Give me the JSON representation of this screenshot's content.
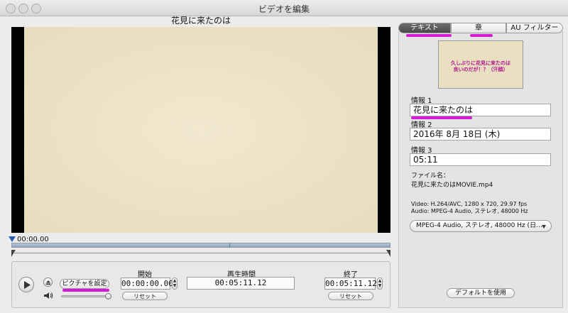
{
  "window": {
    "title": "ビデオを編集"
  },
  "video": {
    "title": "花見に来たのは",
    "timecode": "00:00.00"
  },
  "controls": {
    "set_picture_label": "ピクチャを設定",
    "start": {
      "label": "開始",
      "value": "00:00:00.00",
      "reset": "リセット"
    },
    "duration": {
      "label": "再生時間",
      "value": "00:05:11.12"
    },
    "end": {
      "label": "終了",
      "value": "00:05:11.12",
      "reset": "リセット"
    }
  },
  "tabs": [
    {
      "label": "テキスト",
      "active": true
    },
    {
      "label": "章",
      "active": false
    },
    {
      "label": "AU フィルター",
      "active": false
    }
  ],
  "thumbnail": {
    "text_line1": "久しぶりに花見に来たのは",
    "text_line2": "良いのだが！？（汗顔）"
  },
  "info": {
    "info1_label": "情報 1",
    "info1_value": "花見に来たのは",
    "info2_label": "情報 2",
    "info2_value": "2016年 8月 18日 (木)",
    "info3_label": "情報 3",
    "info3_value": "05:11"
  },
  "file": {
    "name_label": "ファイル名：",
    "name_value": "花見に来たのはMOVIE.mp4",
    "video_line": "Video: H.264/AVC, 1280 x 720, 29.97 fps",
    "audio_line": "Audio: MPEG-4 Audio, ステレオ, 48000 Hz"
  },
  "audio_select": {
    "value": "MPEG-4 Audio, ステレオ, 48000 Hz (日…"
  },
  "default_button": "デフォルトを使用",
  "colors": {
    "highlight": "#d51ad5",
    "video_bg": "#ede3c6",
    "accent_blue": "#2a5db0"
  }
}
